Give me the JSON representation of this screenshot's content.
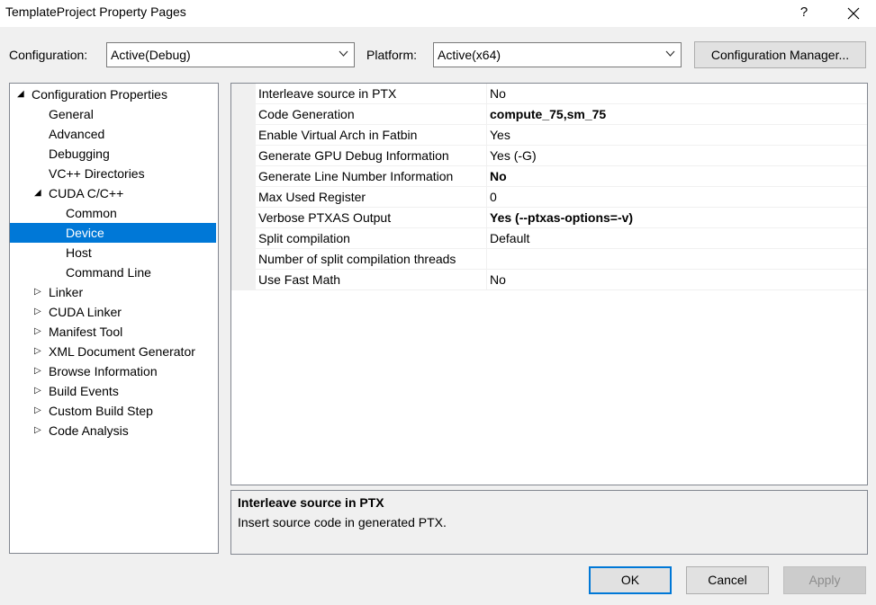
{
  "window": {
    "title": "TemplateProject Property Pages",
    "help_label": "?",
    "icons": {
      "close": "close-icon"
    }
  },
  "toolbar": {
    "configuration_label": "Configuration:",
    "configuration_value": "Active(Debug)",
    "platform_label": "Platform:",
    "platform_value": "Active(x64)",
    "config_manager_label": "Configuration Manager..."
  },
  "tree": [
    {
      "label": "Configuration Properties",
      "glyph": "◢",
      "expanded": true
    },
    {
      "label": "General"
    },
    {
      "label": "Advanced"
    },
    {
      "label": "Debugging"
    },
    {
      "label": "VC++ Directories"
    },
    {
      "label": "CUDA C/C++",
      "glyph": "◢",
      "expanded": true
    },
    {
      "label": "Common"
    },
    {
      "label": "Device",
      "selected": true
    },
    {
      "label": "Host"
    },
    {
      "label": "Command Line"
    },
    {
      "label": "Linker",
      "glyph": "▷"
    },
    {
      "label": "CUDA Linker",
      "glyph": "▷"
    },
    {
      "label": "Manifest Tool",
      "glyph": "▷"
    },
    {
      "label": "XML Document Generator",
      "glyph": "▷"
    },
    {
      "label": "Browse Information",
      "glyph": "▷"
    },
    {
      "label": "Build Events",
      "glyph": "▷"
    },
    {
      "label": "Custom Build Step",
      "glyph": "▷"
    },
    {
      "label": "Code Analysis",
      "glyph": "▷"
    }
  ],
  "properties": [
    {
      "name": "Interleave source in PTX",
      "value": "No",
      "bold": false
    },
    {
      "name": "Code Generation",
      "value": "compute_75,sm_75",
      "bold": true
    },
    {
      "name": "Enable Virtual Arch in Fatbin",
      "value": "Yes",
      "bold": false
    },
    {
      "name": "Generate GPU Debug Information",
      "value": "Yes (-G)",
      "bold": false
    },
    {
      "name": "Generate Line Number Information",
      "value": "No",
      "bold": true
    },
    {
      "name": "Max Used Register",
      "value": "0",
      "bold": false
    },
    {
      "name": "Verbose PTXAS Output",
      "value": "Yes (--ptxas-options=-v)",
      "bold": true
    },
    {
      "name": "Split compilation",
      "value": "Default",
      "bold": false
    },
    {
      "name": "Number of split compilation threads",
      "value": "",
      "bold": false
    },
    {
      "name": "Use Fast Math",
      "value": "No",
      "bold": false
    }
  ],
  "description": {
    "title": "Interleave source in PTX",
    "text": "Insert source code in generated PTX."
  },
  "buttons": {
    "ok": "OK",
    "cancel": "Cancel",
    "apply": "Apply"
  }
}
